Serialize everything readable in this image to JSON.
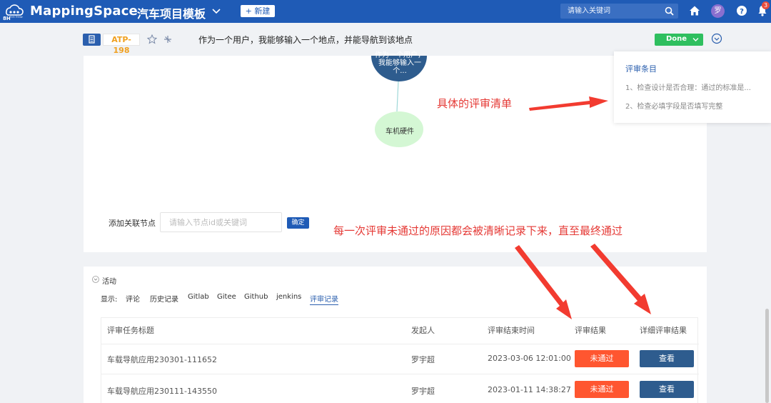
{
  "brand": {
    "logo_text": "8H",
    "logo_sub": "Auto Design",
    "name": "MappingSpace"
  },
  "header": {
    "project_name": "汽车项目模板",
    "new_button": "+ 新建",
    "search_placeholder": "请输入关键词",
    "avatar_initial": "罗",
    "notification_count": "3"
  },
  "issue": {
    "key": "ATP-198",
    "title": "作为一个用户，我能够输入一个地点，并能导航到该地点",
    "status": "Done"
  },
  "mind_map": {
    "top_node_text": "作为一个用户，我能够输入一个...",
    "bottom_node_text": "车机硬件",
    "add_label": "添加关联节点",
    "input_placeholder": "请输入节点id或关键词",
    "confirm_button": "确定"
  },
  "review_popup": {
    "title": "评审条目",
    "items": [
      "1、检查设计是否合理：通过的标准是...",
      "2、检查必填字段是否填写完整"
    ]
  },
  "annotations": {
    "checklist_note": "具体的评审清单",
    "record_note": "每一次评审未通过的原因都会被清晰记录下来，直至最终通过"
  },
  "activity": {
    "title": "活动",
    "show_label": "显示:",
    "tabs": [
      "评论",
      "历史记录",
      "Gitlab",
      "Gitee",
      "Github",
      "jenkins",
      "评审记录"
    ],
    "active_tab": "评审记录",
    "columns": [
      "评审任务标题",
      "发起人",
      "评审结束时间",
      "评审结果",
      "详细评审结果"
    ],
    "rows": [
      {
        "title": "车载导航应用230301-111652",
        "initiator": "罗宇超",
        "end_time": "2023-03-06 12:01:00",
        "result": "未通过",
        "action": "查看"
      },
      {
        "title": "车载导航应用230111-143550",
        "initiator": "罗宇超",
        "end_time": "2023-01-11 14:38:27",
        "result": "未通过",
        "action": "查看"
      }
    ]
  },
  "colors": {
    "primary": "#1f5bb6",
    "done": "#2fbf5f",
    "fail": "#ff5630",
    "view": "#2e5c8e",
    "annotation": "#e53935",
    "node_top": "#2e5c8e",
    "node_bottom": "#d4f7d4"
  }
}
